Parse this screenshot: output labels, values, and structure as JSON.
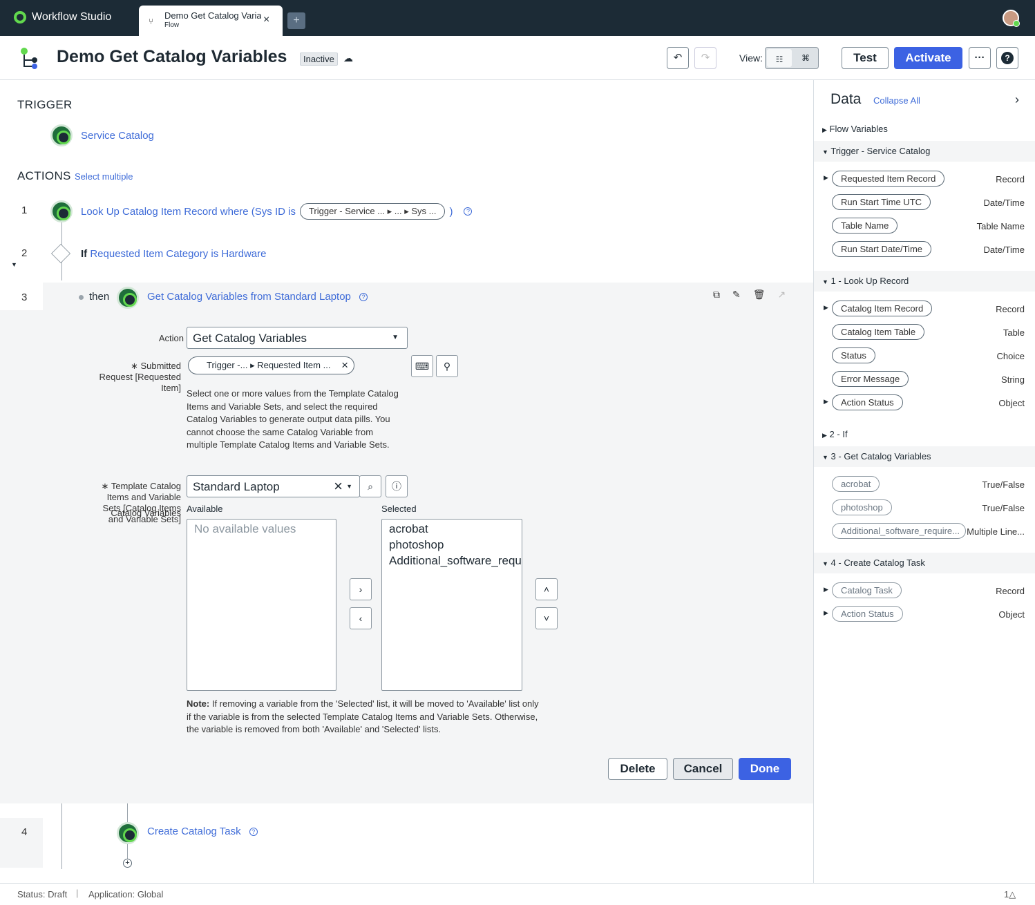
{
  "app": {
    "name": "Workflow Studio"
  },
  "tab": {
    "title": "Demo Get Catalog Varia",
    "subtitle": "Flow",
    "close": "×",
    "new": "+"
  },
  "header": {
    "title": "Demo Get Catalog Variables",
    "state": "Inactive",
    "view_label": "View:",
    "test": "Test",
    "activate": "Activate",
    "more": "···",
    "help": "?"
  },
  "trigger": {
    "heading": "TRIGGER",
    "name": "Service Catalog"
  },
  "actions": {
    "heading": "ACTIONS",
    "select_multiple": "Select multiple",
    "steps": [
      {
        "num": "1",
        "text": "Look Up Catalog Item Record where (Sys ID is",
        "pill": "Trigger - Service ...  ▸ ...  ▸ Sys ...",
        "close": ")"
      },
      {
        "num": "2",
        "prefix": "If",
        "text": "Requested Item Category is Hardware"
      },
      {
        "num": "3",
        "prefix": "then",
        "text": "Get Catalog Variables from Standard Laptop"
      },
      {
        "num": "4",
        "text": "Create Catalog Task"
      }
    ]
  },
  "form": {
    "action_label": "Action",
    "action_value": "Get Catalog Variables",
    "submitted_label_1": "∗ Submitted",
    "submitted_label_2": "Request [Requested",
    "submitted_label_3": "Item]",
    "submitted_pill": "Trigger -...  ▸ Requested Item ...",
    "help_text": "Select one or more values from the Template Catalog Items and Variable Sets, and select the required Catalog Variables to generate output data pills. You cannot choose the same Catalog Variable from multiple Template Catalog Items and Variable Sets.",
    "template_label_1": "∗ Template Catalog",
    "template_label_2": "Items and Variable",
    "template_label_3": "Sets [Catalog Items",
    "template_label_4": "and Variable Sets]",
    "catalog_variables_label": "Catalog Variables",
    "template_value": "Standard Laptop",
    "available_label": "Available",
    "selected_label": "Selected",
    "available_empty": "No available values",
    "selected_items": [
      "acrobat",
      "photoshop",
      "Additional_software_requi"
    ],
    "note_bold": "Note:",
    "note_text": " If removing a variable from the 'Selected' list, it will be moved to 'Available' list only if the variable is from the selected Template Catalog Items and Variable Sets. Otherwise, the variable is removed from both 'Available' and 'Selected' lists.",
    "delete": "Delete",
    "cancel": "Cancel",
    "done": "Done"
  },
  "data_panel": {
    "title": "Data",
    "collapse_all": "Collapse All",
    "groups": [
      {
        "label": "Flow Variables",
        "expanded": false
      },
      {
        "label": "Trigger - Service Catalog",
        "expanded": true,
        "pills": [
          {
            "name": "Requested Item Record",
            "type": "Record",
            "expandable": true
          },
          {
            "name": "Run Start Time UTC",
            "type": "Date/Time"
          },
          {
            "name": "Table Name",
            "type": "Table Name"
          },
          {
            "name": "Run Start Date/Time",
            "type": "Date/Time"
          }
        ]
      },
      {
        "label": "1 - Look Up Record",
        "expanded": true,
        "pills": [
          {
            "name": "Catalog Item Record",
            "type": "Record",
            "expandable": true
          },
          {
            "name": "Catalog Item Table",
            "type": "Table"
          },
          {
            "name": "Status",
            "type": "Choice"
          },
          {
            "name": "Error Message",
            "type": "String"
          },
          {
            "name": "Action Status",
            "type": "Object",
            "expandable": true
          }
        ]
      },
      {
        "label": "2 - If",
        "expanded": false
      },
      {
        "label": "3 - Get Catalog Variables",
        "expanded": true,
        "pills": [
          {
            "name": "acrobat",
            "type": "True/False"
          },
          {
            "name": "photoshop",
            "type": "True/False"
          },
          {
            "name": "Additional_software_require...",
            "type": "Multiple Line..."
          }
        ]
      },
      {
        "label": "4 - Create Catalog Task",
        "expanded": true,
        "pills": [
          {
            "name": "Catalog Task",
            "type": "Record",
            "expandable": true
          },
          {
            "name": "Action Status",
            "type": "Object",
            "expandable": true
          }
        ]
      }
    ]
  },
  "status_bar": {
    "status": "Status: Draft",
    "application": "Application: Global",
    "alerts": "1"
  }
}
